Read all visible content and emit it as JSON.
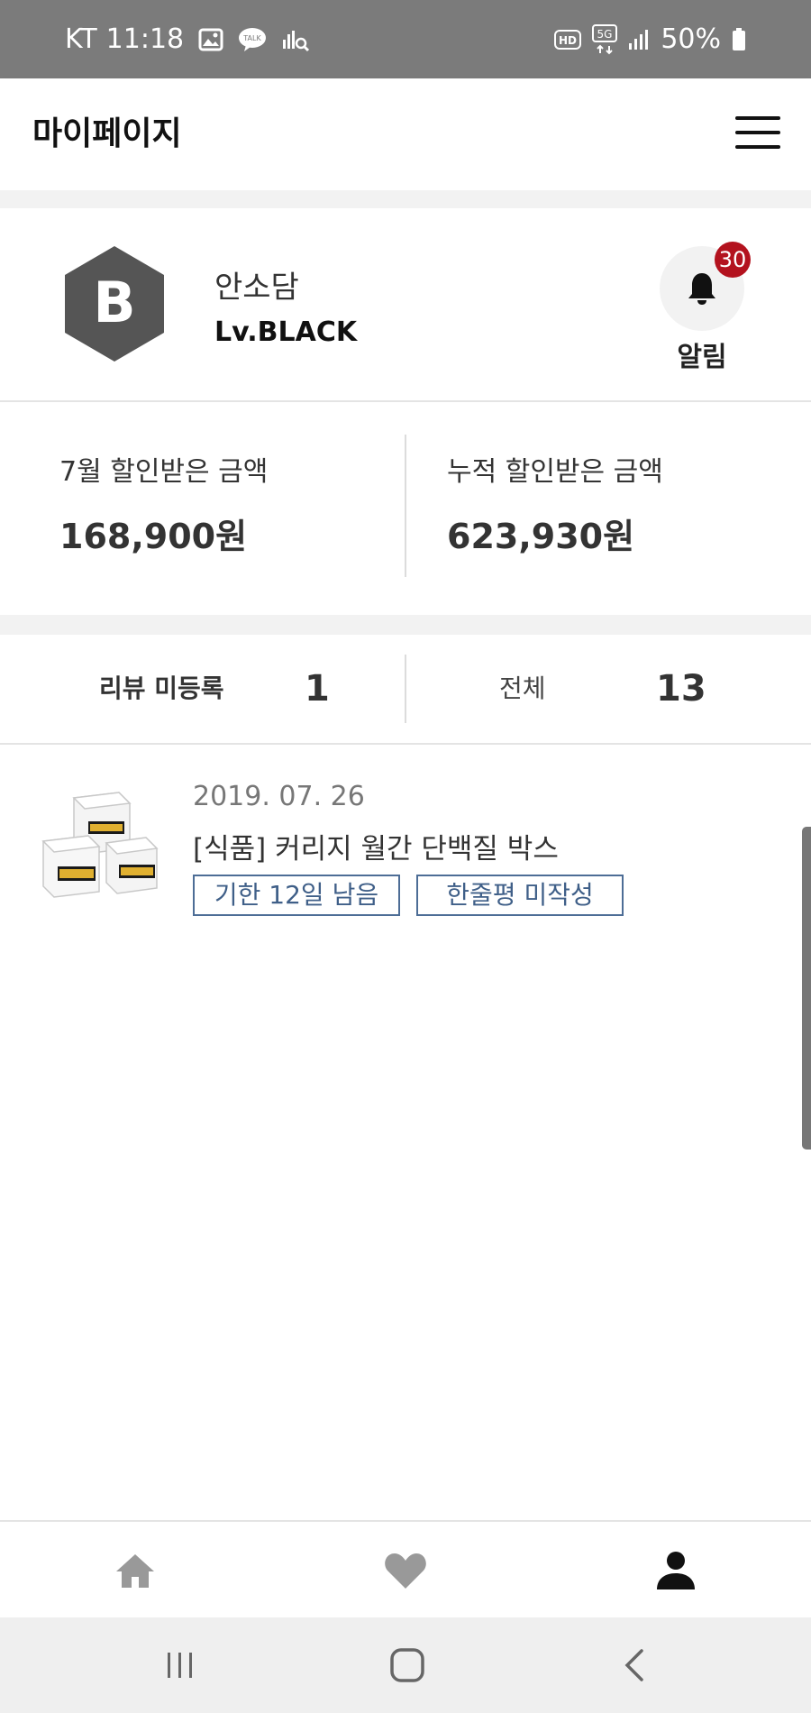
{
  "status_bar": {
    "carrier": "KT",
    "time": "11:18",
    "network": "5G",
    "battery": "50%",
    "icons": [
      "gallery-icon",
      "kakaotalk-icon",
      "search-analytics-icon",
      "hd-icon",
      "5g-icon",
      "signal-icon",
      "battery-icon"
    ]
  },
  "header": {
    "title": "마이페이지",
    "menu_icon": "hamburger-menu-icon"
  },
  "profile": {
    "grade_letter": "B",
    "name": "안소담",
    "level": "Lv.BLACK",
    "alarm_count": "30",
    "alarm_label": "알림"
  },
  "amounts": {
    "month_label": "7월 할인받은 금액",
    "month_value": "168,900원",
    "total_label": "누적 할인받은 금액",
    "total_value": "623,930원"
  },
  "review_tabs": [
    {
      "label": "리뷰 미등록",
      "count": "1",
      "active": true
    },
    {
      "label": "전체",
      "count": "13",
      "active": false
    }
  ],
  "reviews": [
    {
      "date": "2019. 07. 26",
      "title": "[식품] 커리지 월간 단백질 박스",
      "deadline": "기한 12일 남음",
      "status": "한줄평 미작성"
    }
  ],
  "bottom_nav": [
    "home-icon",
    "heart-icon",
    "person-icon"
  ],
  "colors": {
    "status_bar": "#7b7b7b",
    "badge": "#b3121e",
    "chip": "#4d6d96",
    "hex_grade": "#555555"
  }
}
